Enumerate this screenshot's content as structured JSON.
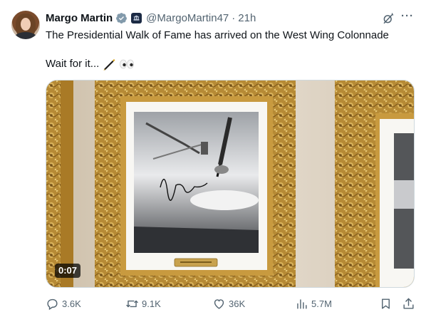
{
  "author": {
    "name": "Margo Martin",
    "handle": "@MargoMartin47",
    "separator": "·",
    "time": "21h"
  },
  "tweet": {
    "text": "The Presidential Walk of Fame has arrived on the West Wing Colonnade",
    "line2": "Wait for it...",
    "emoji_names": [
      "pen-icon",
      "eyes-icon"
    ]
  },
  "media": {
    "duration": "0:07"
  },
  "actions": {
    "replies": "3.6K",
    "reposts": "9.1K",
    "likes": "36K",
    "views": "5.7M"
  },
  "icons": {
    "more": "···"
  },
  "colors": {
    "text": "#0f1419",
    "secondary": "#536471",
    "verified": "#1d9bf0",
    "gold": "#b98b2c"
  }
}
